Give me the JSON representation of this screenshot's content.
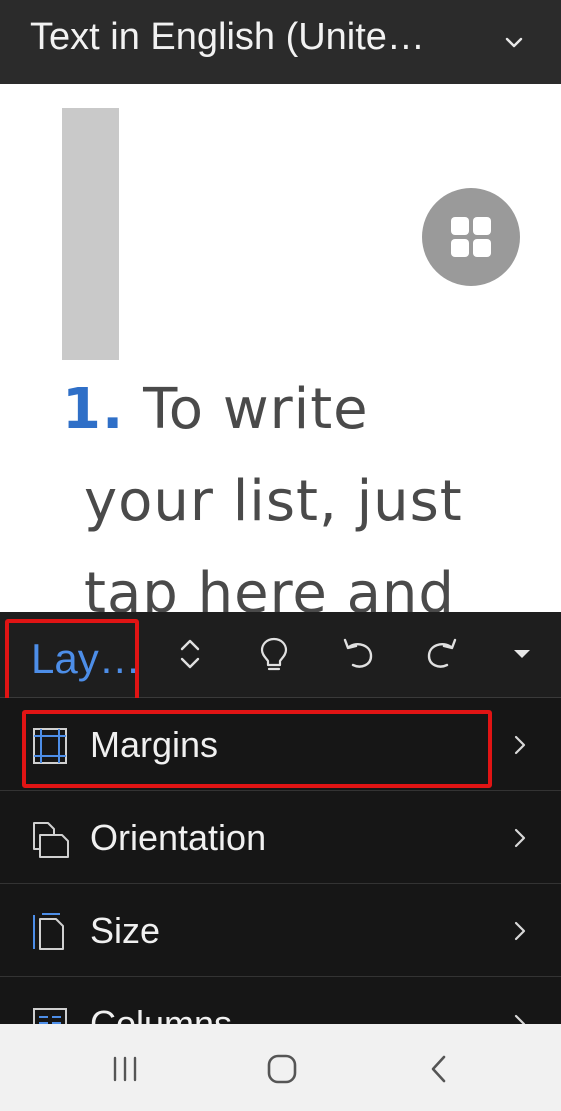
{
  "header": {
    "title": "Text in English (Unite…",
    "chevron_icon": "chevron-down-icon"
  },
  "document": {
    "list_number": "1.",
    "lines": [
      "To write",
      "your list, just",
      "tap here and"
    ],
    "photo_placeholder_icon": "image-placeholder",
    "layout_button_icon": "layout-options-icon"
  },
  "toolbar": {
    "tab_label": "Lay…",
    "icons": [
      "expand-collapse-icon",
      "lightbulb-icon",
      "undo-icon",
      "redo-icon",
      "dropdown-triangle-icon"
    ]
  },
  "menu": {
    "items": [
      {
        "label": "Margins",
        "icon": "margins-icon"
      },
      {
        "label": "Orientation",
        "icon": "orientation-icon"
      },
      {
        "label": "Size",
        "icon": "page-size-icon"
      },
      {
        "label": "Columns",
        "icon": "columns-icon"
      }
    ]
  },
  "navbar": {
    "icons": [
      "recent-apps-icon",
      "home-icon",
      "back-icon"
    ]
  },
  "colors": {
    "accent": "#4d8ee8",
    "list_number": "#2f6fc7",
    "highlight": "#e01414",
    "toolbar_bg": "#1e1e1e",
    "menu_bg": "#161616"
  }
}
